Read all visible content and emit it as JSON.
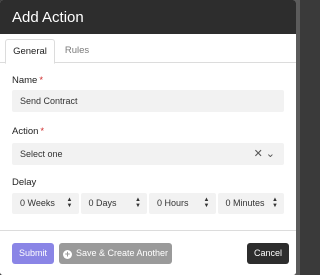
{
  "modal": {
    "title": "Add Action"
  },
  "tabs": [
    {
      "label": "General",
      "active": true
    },
    {
      "label": "Rules",
      "active": false
    }
  ],
  "form": {
    "name": {
      "label": "Name",
      "required_mark": "*",
      "value": "Send Contract"
    },
    "action": {
      "label": "Action",
      "required_mark": "*",
      "value": "Select one",
      "clear_icon": "close-icon",
      "toggle_icon": "chevron-down-icon"
    },
    "delay": {
      "label": "Delay",
      "fields": [
        {
          "value": "0 Weeks"
        },
        {
          "value": "0 Days"
        },
        {
          "value": "0 Hours"
        },
        {
          "value": "0 Minutes"
        }
      ]
    }
  },
  "footer": {
    "submit_label": "Submit",
    "save_create_label": "Save & Create Another",
    "cancel_label": "Cancel"
  },
  "colors": {
    "header_bg": "#2d2d2d",
    "submit_bg": "#8a85e6",
    "secondary_bg": "#9a9a9a",
    "required": "#d02b2b"
  }
}
